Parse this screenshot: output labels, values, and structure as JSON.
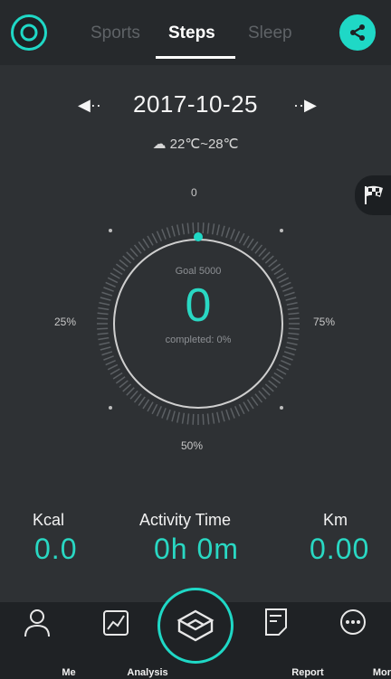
{
  "header": {
    "tabs": [
      {
        "label": "Sports",
        "active": false
      },
      {
        "label": "Steps",
        "active": true
      },
      {
        "label": "Sleep",
        "active": false
      }
    ],
    "left_icon": "power-icon",
    "right_icon": "share-icon"
  },
  "date": {
    "value": "2017-10-25",
    "prev_icon": "arrow-left-icon",
    "next_icon": "arrow-right-icon"
  },
  "weather": {
    "text": "22℃~28℃",
    "icon": "cloud-icon"
  },
  "flag_icon": "checkered-flag-icon",
  "dial": {
    "markers": [
      "0",
      "25%",
      "50%",
      "75%"
    ],
    "goal": "Goal 5000",
    "steps": "0",
    "completed": "completed: 0%",
    "progress_fraction": 0
  },
  "stats": {
    "kcal_label": "Kcal",
    "kcal_value": "0.0",
    "activity_label": "Activity Time",
    "activity_value": "0h 0m",
    "km_label": "Km",
    "km_value": "0.00"
  },
  "nav": {
    "me": "Me",
    "analysis": "Analysis",
    "report": "Report",
    "more": "More"
  },
  "colors": {
    "accent": "#1fd8c6",
    "background": "#2e3134"
  }
}
